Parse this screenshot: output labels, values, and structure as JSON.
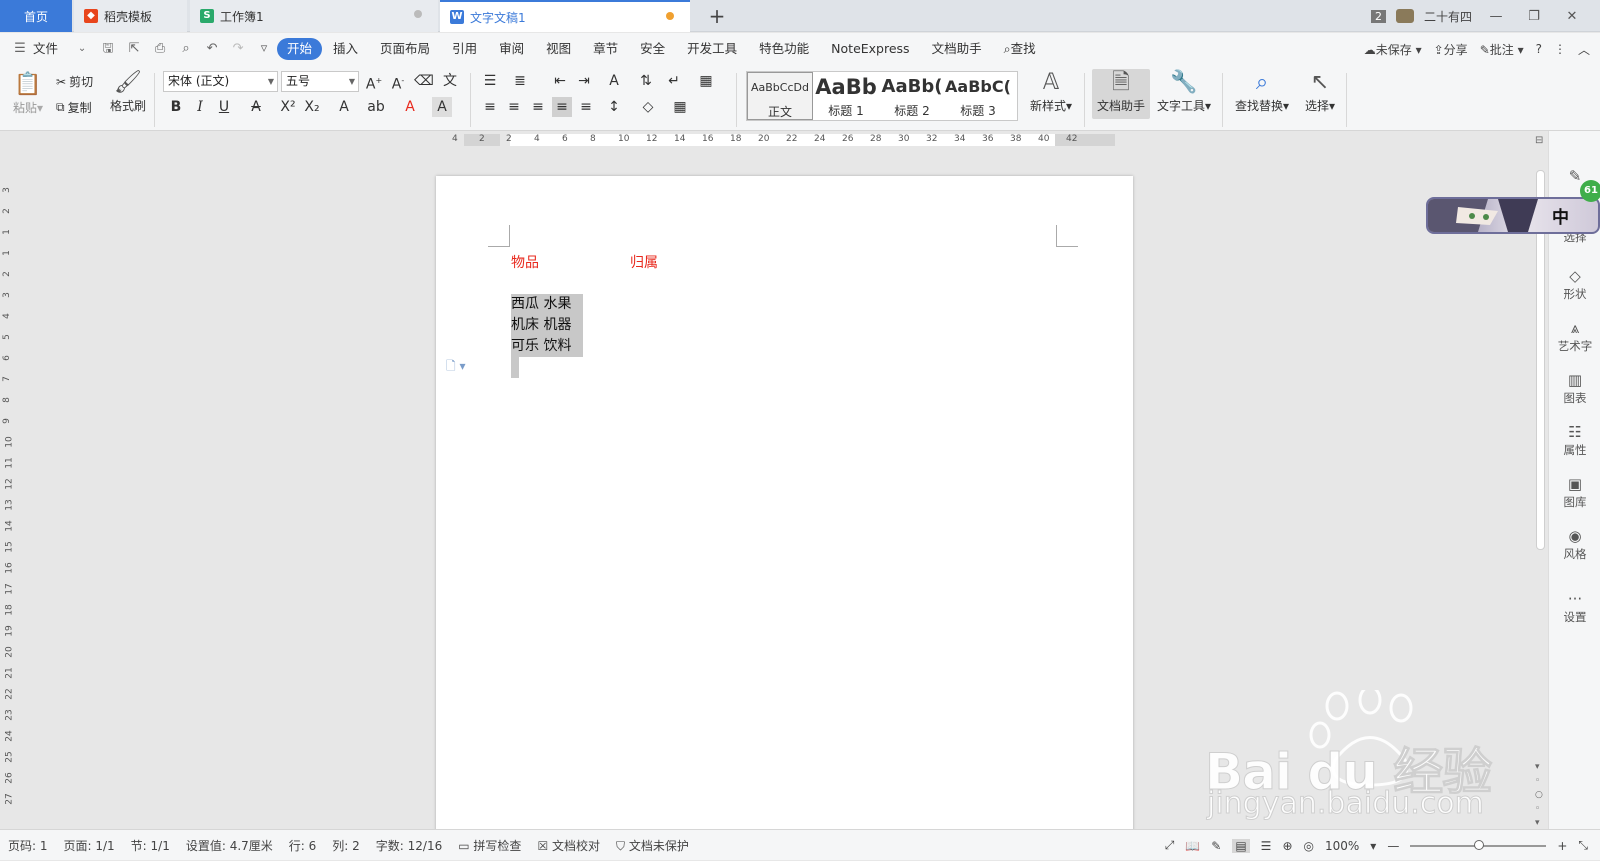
{
  "tabs": {
    "home": "首页",
    "daoke": "稻壳模板",
    "workbook": "工作簿1",
    "document": "文字文稿1",
    "new_tab": "+"
  },
  "window": {
    "badge_count": "2",
    "user": "二十有四",
    "minimize": "—",
    "restore": "❐",
    "close": "✕"
  },
  "menu": {
    "file": "文件",
    "items": [
      "开始",
      "插入",
      "页面布局",
      "引用",
      "审阅",
      "视图",
      "章节",
      "安全",
      "开发工具",
      "特色功能",
      "NoteExpress",
      "文档助手"
    ],
    "search": "查找",
    "unsaved": "未保存",
    "share": "分享",
    "comment": "批注",
    "help": "?"
  },
  "ribbon": {
    "paste": "粘贴",
    "cut": "剪切",
    "copy": "复制",
    "format_painter": "格式刷",
    "font_name": "宋体 (正文)",
    "font_size": "五号",
    "styles": [
      {
        "preview": "AaBbCcDd",
        "name": "正文"
      },
      {
        "preview": "AaBb",
        "name": "标题 1"
      },
      {
        "preview": "AaBb(",
        "name": "标题 2"
      },
      {
        "preview": "AaBbC(",
        "name": "标题 3"
      }
    ],
    "new_style": "新样式",
    "doc_assistant": "文档助手",
    "text_tools": "文字工具",
    "find_replace": "查找替换",
    "select": "选择"
  },
  "ruler": {
    "h": [
      "4",
      "2",
      "2",
      "4",
      "6",
      "8",
      "10",
      "12",
      "14",
      "16",
      "18",
      "20",
      "22",
      "24",
      "26",
      "28",
      "30",
      "32",
      "34",
      "36",
      "38",
      "40",
      "42"
    ],
    "v": [
      "3",
      "2",
      "1",
      "1",
      "2",
      "3",
      "4",
      "5",
      "6",
      "7",
      "8",
      "9",
      "10",
      "11",
      "12",
      "13",
      "14",
      "15",
      "16",
      "17",
      "18",
      "19",
      "20",
      "21",
      "22",
      "23",
      "24",
      "25",
      "26",
      "27"
    ]
  },
  "document": {
    "header_col1": "物品",
    "header_col2": "归属",
    "rows": [
      "西瓜 水果",
      "机床 机器",
      "可乐 饮料"
    ]
  },
  "sidebar": {
    "items": [
      "选择",
      "形状",
      "艺术字",
      "图表",
      "属性",
      "图库",
      "风格",
      "设置"
    ],
    "float_char": "中",
    "float_badge": "61"
  },
  "status": {
    "page_num": "页码: 1",
    "pages": "页面: 1/1",
    "section": "节: 1/1",
    "setting": "设置值: 4.7厘米",
    "row": "行: 6",
    "col": "列: 2",
    "word_count": "字数: 12/16",
    "spell_check": "拼写检查",
    "proofread": "文档校对",
    "protect": "文档未保护",
    "zoom": "100%"
  },
  "watermark": {
    "brand": "Bai du 经验",
    "url": "jingyan.baidu.com"
  },
  "colors": {
    "accent": "#3b7ad9",
    "red_text": "#e8281c",
    "selection": "#c8c8c8"
  }
}
